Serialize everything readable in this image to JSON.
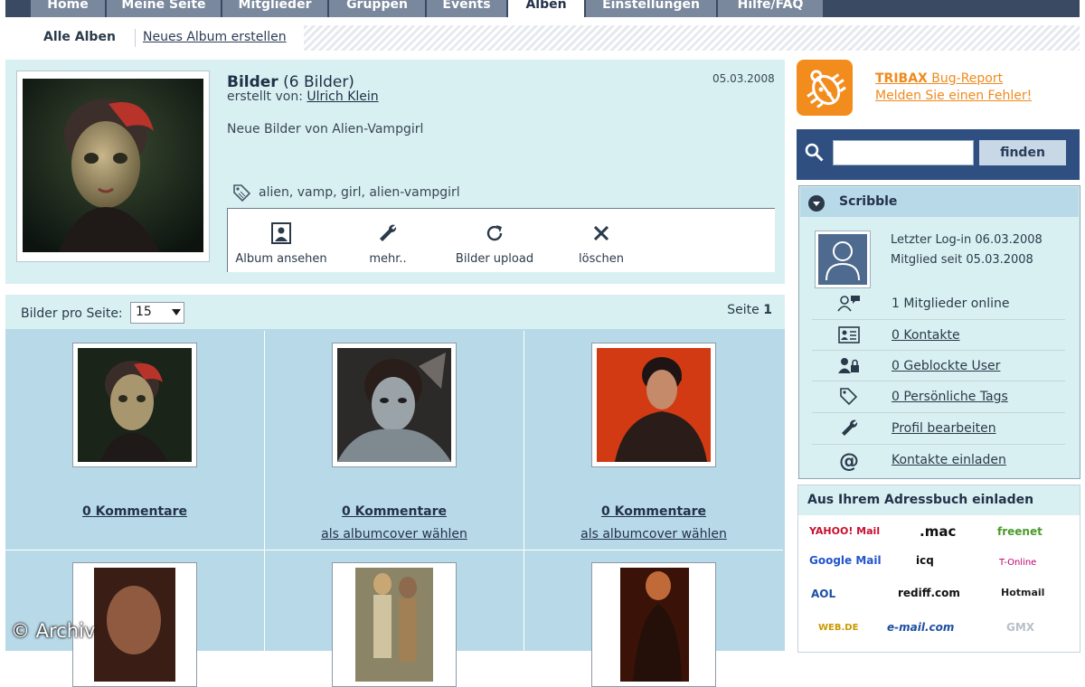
{
  "nav": {
    "tabs": [
      {
        "label": "Home"
      },
      {
        "label": "Meine Seite"
      },
      {
        "label": "Mitglieder"
      },
      {
        "label": "Gruppen"
      },
      {
        "label": "Events"
      },
      {
        "label": "Alben"
      },
      {
        "label": "Einstellungen"
      },
      {
        "label": "Hilfe/FAQ"
      }
    ],
    "active": "Alben"
  },
  "subnav": {
    "current": "Alle Alben",
    "new_album": "Neues Album erstellen"
  },
  "album": {
    "title": "Bilder",
    "count_text": "(6 Bilder)",
    "date": "05.03.2008",
    "created_by_label": "erstellt von:",
    "creator": "Ulrich Klein",
    "description": "Neue Bilder von Alien-Vampgirl",
    "tags": "alien, vamp, girl, alien-vampgirl",
    "actions": {
      "view": "Album ansehen",
      "more": "mehr..",
      "upload": "Bilder upload",
      "delete": "löschen"
    }
  },
  "gallery": {
    "per_page_label": "Bilder pro Seite:",
    "per_page_value": "15",
    "page_label": "Seite",
    "page_number": "1",
    "items": [
      {
        "comments": "0 Kommentare",
        "cover": ""
      },
      {
        "comments": "0 Kommentare",
        "cover": "als albumcover wählen"
      },
      {
        "comments": "0 Kommentare",
        "cover": "als albumcover wählen"
      }
    ]
  },
  "watermark": "© Archiv",
  "sidebar": {
    "report": {
      "brand": "TRIBAX",
      "title_rest": " Bug-Report",
      "subtitle": "Melden Sie einen Fehler!"
    },
    "search": {
      "button": "finden",
      "value": ""
    },
    "user": {
      "name": "Scribble",
      "last_login": "Letzter Log-in 06.03.2008",
      "member_since": "Mitglied seit 05.03.2008",
      "items": [
        {
          "label": "1 Mitglieder online",
          "icon": "members-online-icon"
        },
        {
          "label": "0 Kontakte",
          "icon": "contacts-icon"
        },
        {
          "label": "0 Geblockte User",
          "icon": "blocked-users-icon"
        },
        {
          "label": "0 Persönliche Tags",
          "icon": "tag-icon"
        },
        {
          "label": "Profil bearbeiten",
          "icon": "wrench-icon"
        },
        {
          "label": "Kontakte einladen",
          "icon": "at-icon"
        }
      ]
    },
    "invite": {
      "title": "Aus Ihrem Adressbuch einladen",
      "providers": [
        "YAHOO! Mail",
        ".mac",
        "freenet",
        "Google Mail",
        "icq",
        "T-Online",
        "AOL",
        "rediff.com",
        "Hotmail",
        "WEB.DE",
        "e-mail.com",
        "GMX"
      ]
    }
  },
  "colors": {
    "nav_bar": "#3b4a63",
    "panel": "#d8f0f2",
    "gallery": "#b8d9e8",
    "accent": "#f08a1c",
    "search_bg": "#2e4f80"
  }
}
